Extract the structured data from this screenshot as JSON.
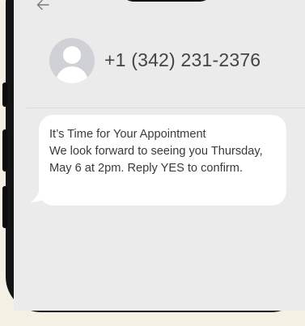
{
  "contact": {
    "phone": "+1 (342) 231-2376"
  },
  "message": {
    "lines": [
      "It’s Time for Your Appointment",
      "We look forward to seeing you Thursday,",
      "May 6 at 2pm. Reply YES to confirm."
    ]
  },
  "icons": {
    "back": "arrow-left-icon",
    "avatar": "person-icon"
  },
  "colors": {
    "background": "#f5f0e4",
    "screen": "#ebebeb",
    "bubble": "#ffffff",
    "avatar": "#cfd1d6"
  }
}
